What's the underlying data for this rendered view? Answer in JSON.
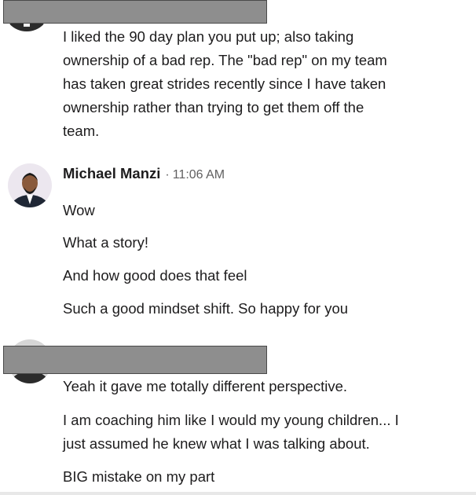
{
  "messages": [
    {
      "sender": "",
      "time": "",
      "lines": [
        "I liked the 90 day plan you put up; also taking",
        "ownership of a bad rep.  The \"bad rep\" on my team",
        "has taken great strides recently since I have taken",
        "ownership rather than trying to get them off the",
        "team."
      ]
    },
    {
      "sender": "Michael Manzi",
      "separator": "·",
      "time": "11:06 AM",
      "lines": [
        "Wow",
        "What a story!",
        "And how good does that feel",
        "Such a good mindset shift. So happy for you"
      ]
    },
    {
      "sender": "",
      "time": "",
      "lines": [
        "Yeah it gave me totally different perspective.",
        "I am coaching him like I would my young children... I",
        "just assumed he knew what I was talking about.",
        "BIG mistake on my part"
      ]
    }
  ],
  "colors": {
    "text": "#1d1c1d",
    "timestamp": "#616061",
    "redaction": "#8e8e8e"
  }
}
